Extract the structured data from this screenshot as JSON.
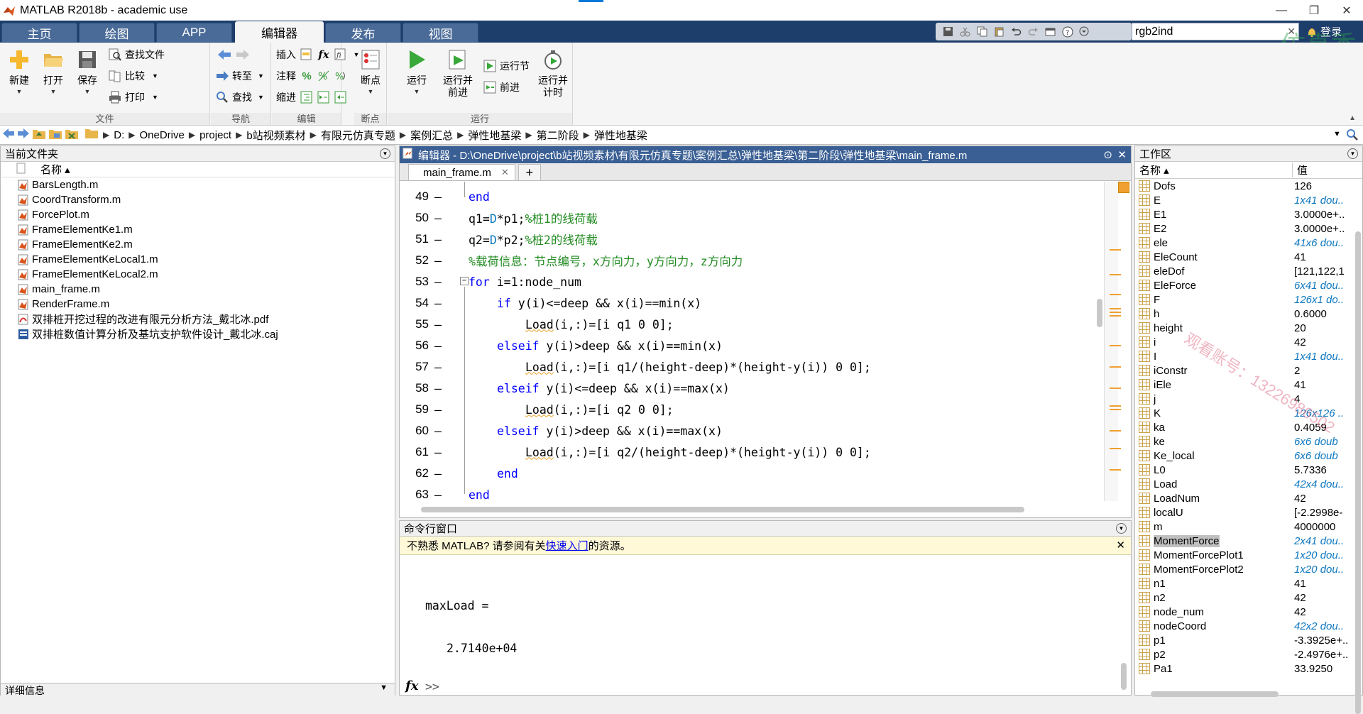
{
  "window": {
    "title": "MATLAB R2018b - academic use",
    "controls": [
      "—",
      "❐",
      "✕"
    ]
  },
  "tabs": [
    {
      "label": "主页"
    },
    {
      "label": "绘图"
    },
    {
      "label": "APP"
    },
    {
      "label": "编辑器",
      "active": true
    },
    {
      "label": "发布"
    },
    {
      "label": "视图"
    }
  ],
  "search": {
    "value": "rgb2ind",
    "clear": "✕"
  },
  "login": "登录",
  "watermark_logo": "仿真秀",
  "ribbon": {
    "file": {
      "new": "新建",
      "open": "打开",
      "save": "保存",
      "find_files": "查找文件",
      "compare": "比较",
      "print": "打印",
      "group": "文件"
    },
    "navigate": {
      "goto": "转至",
      "find": "查找",
      "group": "导航"
    },
    "edit": {
      "insert": "插入",
      "comment": "注释",
      "indent": "缩进",
      "fx": "fx",
      "percent": "%",
      "group": "编辑"
    },
    "breakpoints": {
      "label": "断点",
      "group": "断点"
    },
    "run": {
      "run": "运行",
      "run_advance": "运行并\n前进",
      "run_section": "运行节",
      "advance": "前进",
      "run_time": "运行并\n计时",
      "group": "运行"
    }
  },
  "address": {
    "crumbs": [
      "D:",
      "OneDrive",
      "project",
      "b站视频素材",
      "有限元仿真专题",
      "案例汇总",
      "弹性地基梁",
      "第二阶段",
      "弹性地基梁"
    ]
  },
  "current_folder": {
    "title": "当前文件夹",
    "column": "名称 ▴",
    "files": [
      {
        "name": "BarsLength.m",
        "kind": "m"
      },
      {
        "name": "CoordTransform.m",
        "kind": "m"
      },
      {
        "name": "ForcePlot.m",
        "kind": "m"
      },
      {
        "name": "FrameElementKe1.m",
        "kind": "m"
      },
      {
        "name": "FrameElementKe2.m",
        "kind": "m"
      },
      {
        "name": "FrameElementKeLocal1.m",
        "kind": "m"
      },
      {
        "name": "FrameElementKeLocal2.m",
        "kind": "m"
      },
      {
        "name": "main_frame.m",
        "kind": "m"
      },
      {
        "name": "RenderFrame.m",
        "kind": "m"
      },
      {
        "name": "双排桩开挖过程的改进有限元分析方法_戴北冰.pdf",
        "kind": "pdf"
      },
      {
        "name": "双排桩数值计算分析及基坑支护软件设计_戴北冰.caj",
        "kind": "caj"
      }
    ],
    "details": "详细信息"
  },
  "editor": {
    "title": "编辑器 - D:\\OneDrive\\project\\b站视频素材\\有限元仿真专题\\案例汇总\\弹性地基梁\\第二阶段\\弹性地基梁\\main_frame.m",
    "tab": "main_frame.m",
    "tab_close": "✕",
    "add_tab": "+",
    "lines": [
      {
        "n": "49",
        "html_parts": [
          {
            "t": "end",
            "c": "kw"
          }
        ],
        "indent": 1
      },
      {
        "n": "50",
        "html_parts": [
          {
            "t": "q1="
          },
          {
            "t": "D",
            "c": "vr"
          },
          {
            "t": "*p1;"
          },
          {
            "t": "%桩1的线荷载",
            "c": "cm"
          }
        ],
        "indent": 1
      },
      {
        "n": "51",
        "html_parts": [
          {
            "t": "q2="
          },
          {
            "t": "D",
            "c": "vr"
          },
          {
            "t": "*p2;"
          },
          {
            "t": "%桩2的线荷载",
            "c": "cm"
          }
        ],
        "indent": 1
      },
      {
        "n": "52",
        "html_parts": [
          {
            "t": "%载荷信息：节点编号，x方向力，y方向力，z方向力",
            "c": "cm"
          }
        ],
        "indent": 1
      },
      {
        "n": "53",
        "html_parts": [
          {
            "t": "for",
            "c": "kw"
          },
          {
            "t": " i=1:node_num"
          }
        ],
        "indent": 1
      },
      {
        "n": "54",
        "html_parts": [
          {
            "t": "if",
            "c": "kw"
          },
          {
            "t": " y(i)<=deep && x(i)==min(x)"
          }
        ],
        "indent": 2
      },
      {
        "n": "55",
        "html_parts": [
          {
            "t": "Load",
            "c": "ul"
          },
          {
            "t": "(i,:)=[i q1 0 0];"
          }
        ],
        "indent": 3
      },
      {
        "n": "56",
        "html_parts": [
          {
            "t": "elseif",
            "c": "kw"
          },
          {
            "t": " y(i)>deep && x(i)==min(x)"
          }
        ],
        "indent": 2
      },
      {
        "n": "57",
        "html_parts": [
          {
            "t": "Load",
            "c": "ul"
          },
          {
            "t": "(i,:)=[i q1/(height-deep)*(height-y(i)) 0 0];"
          }
        ],
        "indent": 3
      },
      {
        "n": "58",
        "html_parts": [
          {
            "t": "elseif",
            "c": "kw"
          },
          {
            "t": " y(i)<=deep && x(i)==max(x)"
          }
        ],
        "indent": 2
      },
      {
        "n": "59",
        "html_parts": [
          {
            "t": "Load",
            "c": "ul"
          },
          {
            "t": "(i,:)=[i q2 0 0];"
          }
        ],
        "indent": 3
      },
      {
        "n": "60",
        "html_parts": [
          {
            "t": "elseif",
            "c": "kw"
          },
          {
            "t": " y(i)>deep && x(i)==max(x)"
          }
        ],
        "indent": 2
      },
      {
        "n": "61",
        "html_parts": [
          {
            "t": "Load",
            "c": "ul"
          },
          {
            "t": "(i,:)=[i q2/(height-deep)*(height-y(i)) 0 0];"
          }
        ],
        "indent": 3
      },
      {
        "n": "62",
        "html_parts": [
          {
            "t": "end",
            "c": "kw"
          }
        ],
        "indent": 2
      },
      {
        "n": "63",
        "html_parts": [
          {
            "t": "end",
            "c": "kw"
          }
        ],
        "indent": 1
      }
    ]
  },
  "command": {
    "title": "命令行窗口",
    "notice_pre": "不熟悉 MATLAB? 请参阅有关",
    "notice_link": "快速入门",
    "notice_post": "的资源。",
    "notice_close": "✕",
    "output_var": "maxLoad =",
    "output_val": "2.7140e+04",
    "prompt_fx": "fx",
    "prompt": ">>"
  },
  "workspace": {
    "title": "工作区",
    "col_name": "名称 ▴",
    "col_value": "值",
    "vars": [
      {
        "name": "Dofs",
        "value": "126"
      },
      {
        "name": "E",
        "value": "1x41 dou..",
        "italic": true
      },
      {
        "name": "E1",
        "value": "3.0000e+.."
      },
      {
        "name": "E2",
        "value": "3.0000e+.."
      },
      {
        "name": "ele",
        "value": "41x6 dou..",
        "italic": true
      },
      {
        "name": "EleCount",
        "value": "41"
      },
      {
        "name": "eleDof",
        "value": "[121,122,1"
      },
      {
        "name": "EleForce",
        "value": "6x41 dou..",
        "italic": true
      },
      {
        "name": "F",
        "value": "126x1 do..",
        "italic": true
      },
      {
        "name": "h",
        "value": "0.6000"
      },
      {
        "name": "height",
        "value": "20"
      },
      {
        "name": "i",
        "value": "42"
      },
      {
        "name": "I",
        "value": "1x41 dou..",
        "italic": true
      },
      {
        "name": "iConstr",
        "value": "2"
      },
      {
        "name": "iEle",
        "value": "41"
      },
      {
        "name": "j",
        "value": "4"
      },
      {
        "name": "K",
        "value": "126x126 ..",
        "italic": true
      },
      {
        "name": "ka",
        "value": "0.4059"
      },
      {
        "name": "ke",
        "value": "6x6 doub",
        "italic": true
      },
      {
        "name": "Ke_local",
        "value": "6x6 doub",
        "italic": true
      },
      {
        "name": "L0",
        "value": "5.7336"
      },
      {
        "name": "Load",
        "value": "42x4 dou..",
        "italic": true
      },
      {
        "name": "LoadNum",
        "value": "42"
      },
      {
        "name": "localU",
        "value": "[-2.2998e-"
      },
      {
        "name": "m",
        "value": "4000000"
      },
      {
        "name": "MomentForce",
        "value": "2x41 dou..",
        "italic": true,
        "selected": true
      },
      {
        "name": "MomentForcePlot1",
        "value": "1x20 dou..",
        "italic": true
      },
      {
        "name": "MomentForcePlot2",
        "value": "1x20 dou..",
        "italic": true
      },
      {
        "name": "n1",
        "value": "41"
      },
      {
        "name": "n2",
        "value": "42"
      },
      {
        "name": "node_num",
        "value": "42"
      },
      {
        "name": "nodeCoord",
        "value": "42x2 dou..",
        "italic": true
      },
      {
        "name": "p1",
        "value": "-3.3925e+.."
      },
      {
        "name": "p2",
        "value": "-2.4976e+.."
      },
      {
        "name": "Pa1",
        "value": "33.9250"
      }
    ]
  },
  "overlay_watermark": "观看账号：13226986502"
}
